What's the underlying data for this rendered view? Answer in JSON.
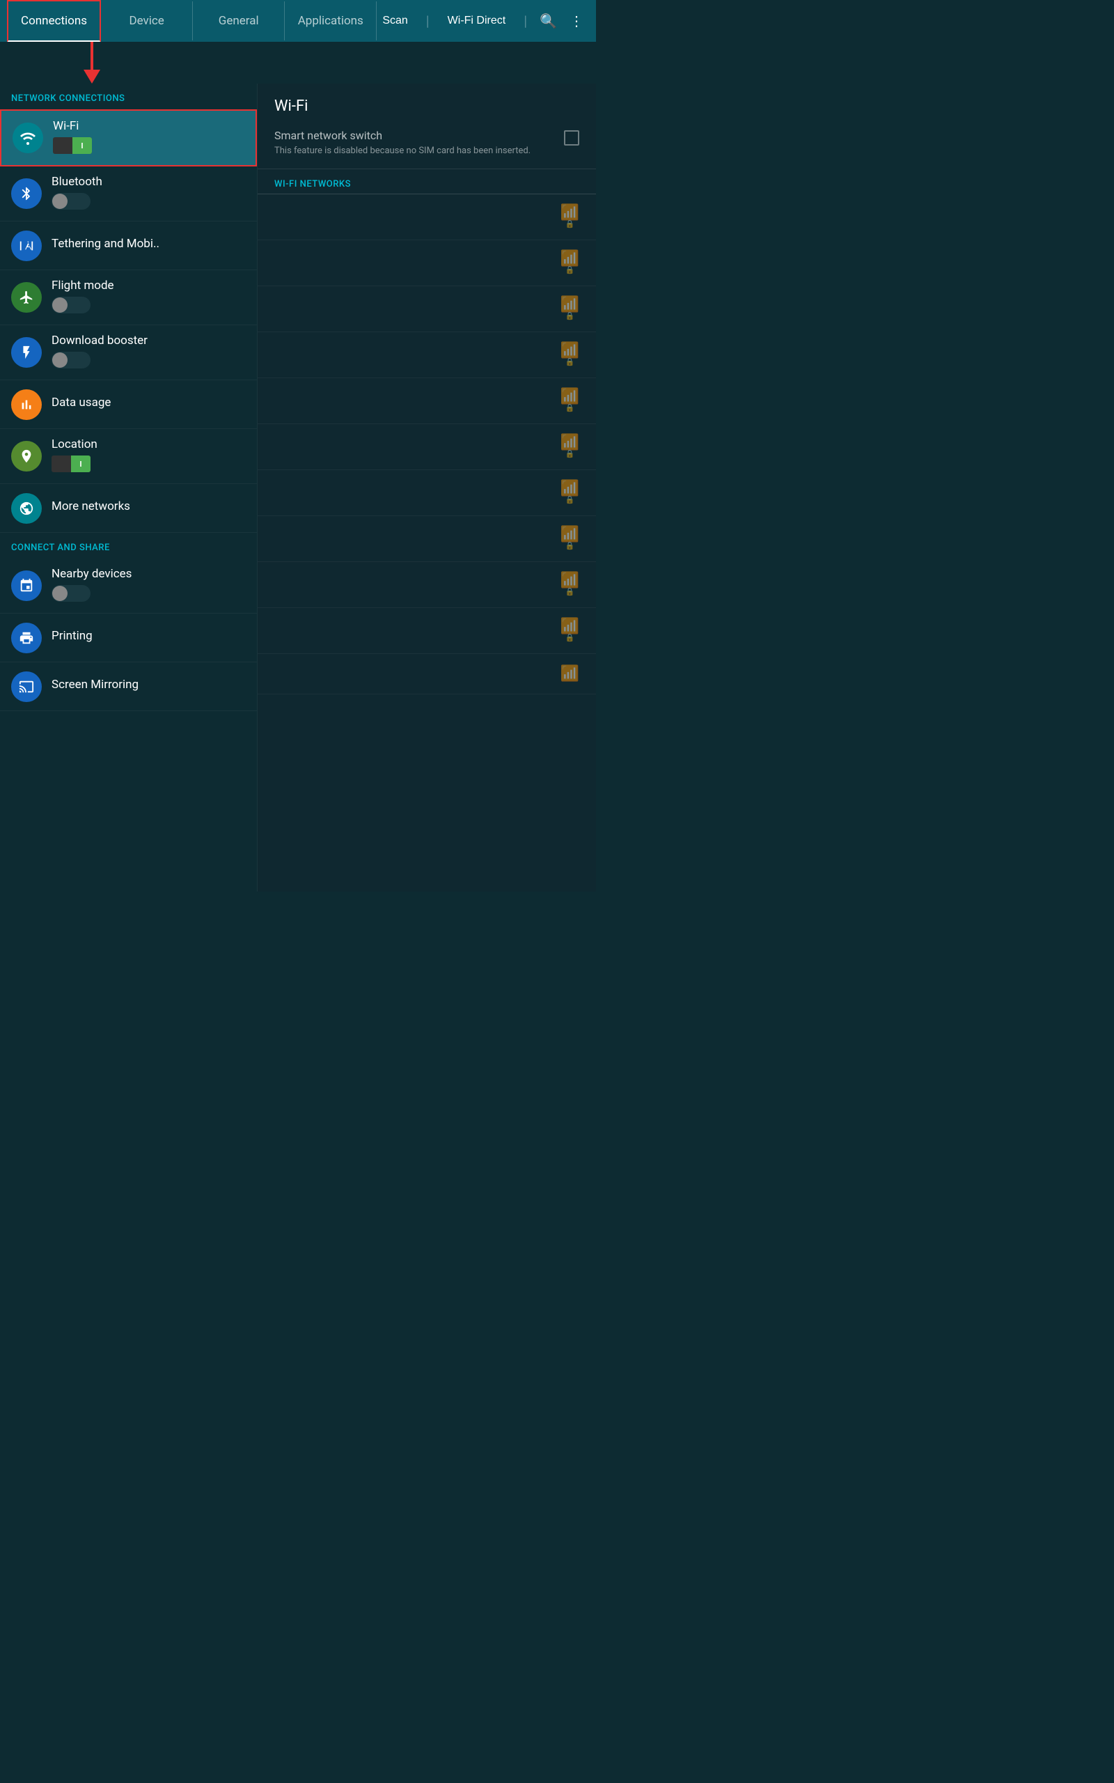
{
  "tabs": [
    {
      "label": "Connections",
      "active": true
    },
    {
      "label": "Device",
      "active": false
    },
    {
      "label": "General",
      "active": false
    },
    {
      "label": "Applications",
      "active": false
    }
  ],
  "toolbar": {
    "scan": "Scan",
    "wifidirect": "Wi-Fi Direct",
    "search_icon": "search",
    "more_icon": "⋮"
  },
  "left_panel": {
    "network_connections_header": "NETWORK CONNECTIONS",
    "connect_share_header": "CONNECT AND SHARE",
    "items": [
      {
        "id": "wifi",
        "label": "Wi-Fi",
        "icon": "wifi",
        "icon_color": "icon-teal",
        "toggle": "on",
        "highlighted": true
      },
      {
        "id": "bluetooth",
        "label": "Bluetooth",
        "icon": "bluetooth",
        "icon_color": "icon-blue",
        "toggle": "off"
      },
      {
        "id": "tethering",
        "label": "Tethering and Mobi..",
        "icon": "tethering",
        "icon_color": "icon-blue",
        "toggle": null
      },
      {
        "id": "flightmode",
        "label": "Flight mode",
        "icon": "flight",
        "icon_color": "icon-green",
        "toggle": "off"
      },
      {
        "id": "downloadbooster",
        "label": "Download booster",
        "icon": "bolt",
        "icon_color": "icon-blue",
        "toggle": "off"
      },
      {
        "id": "datausage",
        "label": "Data usage",
        "icon": "chart",
        "icon_color": "icon-yellow",
        "toggle": null
      },
      {
        "id": "location",
        "label": "Location",
        "icon": "pin",
        "icon_color": "icon-lime",
        "toggle": "on"
      },
      {
        "id": "morenetworks",
        "label": "More networks",
        "icon": "globe",
        "icon_color": "icon-teal",
        "toggle": null
      },
      {
        "id": "nearbydevices",
        "label": "Nearby devices",
        "icon": "nearby",
        "icon_color": "icon-blue",
        "toggle": "off"
      },
      {
        "id": "printing",
        "label": "Printing",
        "icon": "print",
        "icon_color": "icon-blue",
        "toggle": null
      },
      {
        "id": "screenmirroring",
        "label": "Screen Mirroring",
        "icon": "mirror",
        "icon_color": "icon-blue",
        "toggle": null
      }
    ]
  },
  "right_panel": {
    "title": "Wi-Fi",
    "smart_switch_label": "Smart network switch",
    "smart_switch_desc": "This feature is disabled because no SIM card has been inserted.",
    "wifi_networks_header": "WI-FI NETWORKS",
    "networks_count": 11
  }
}
